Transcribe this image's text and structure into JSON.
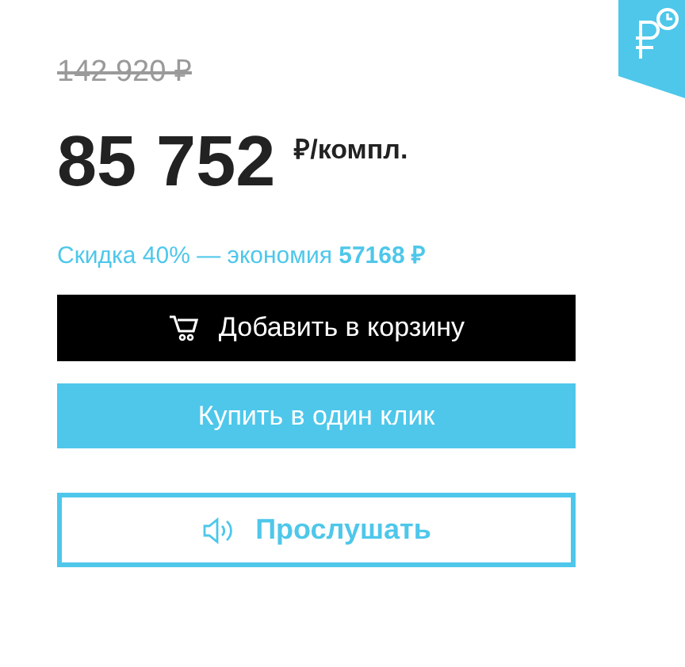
{
  "old_price": "142 920 ₽",
  "price": {
    "amount": "85 752",
    "unit": "₽/компл."
  },
  "discount": "Скидка 40% — экономия **57168 ₽**",
  "buttons": [
    {
      "kind": "cart",
      "label": "Добавить в корзину"
    },
    {
      "kind": "quick",
      "label": "Купить в один клик"
    },
    {
      "kind": "listen",
      "label": "Прослушать"
    }
  ]
}
